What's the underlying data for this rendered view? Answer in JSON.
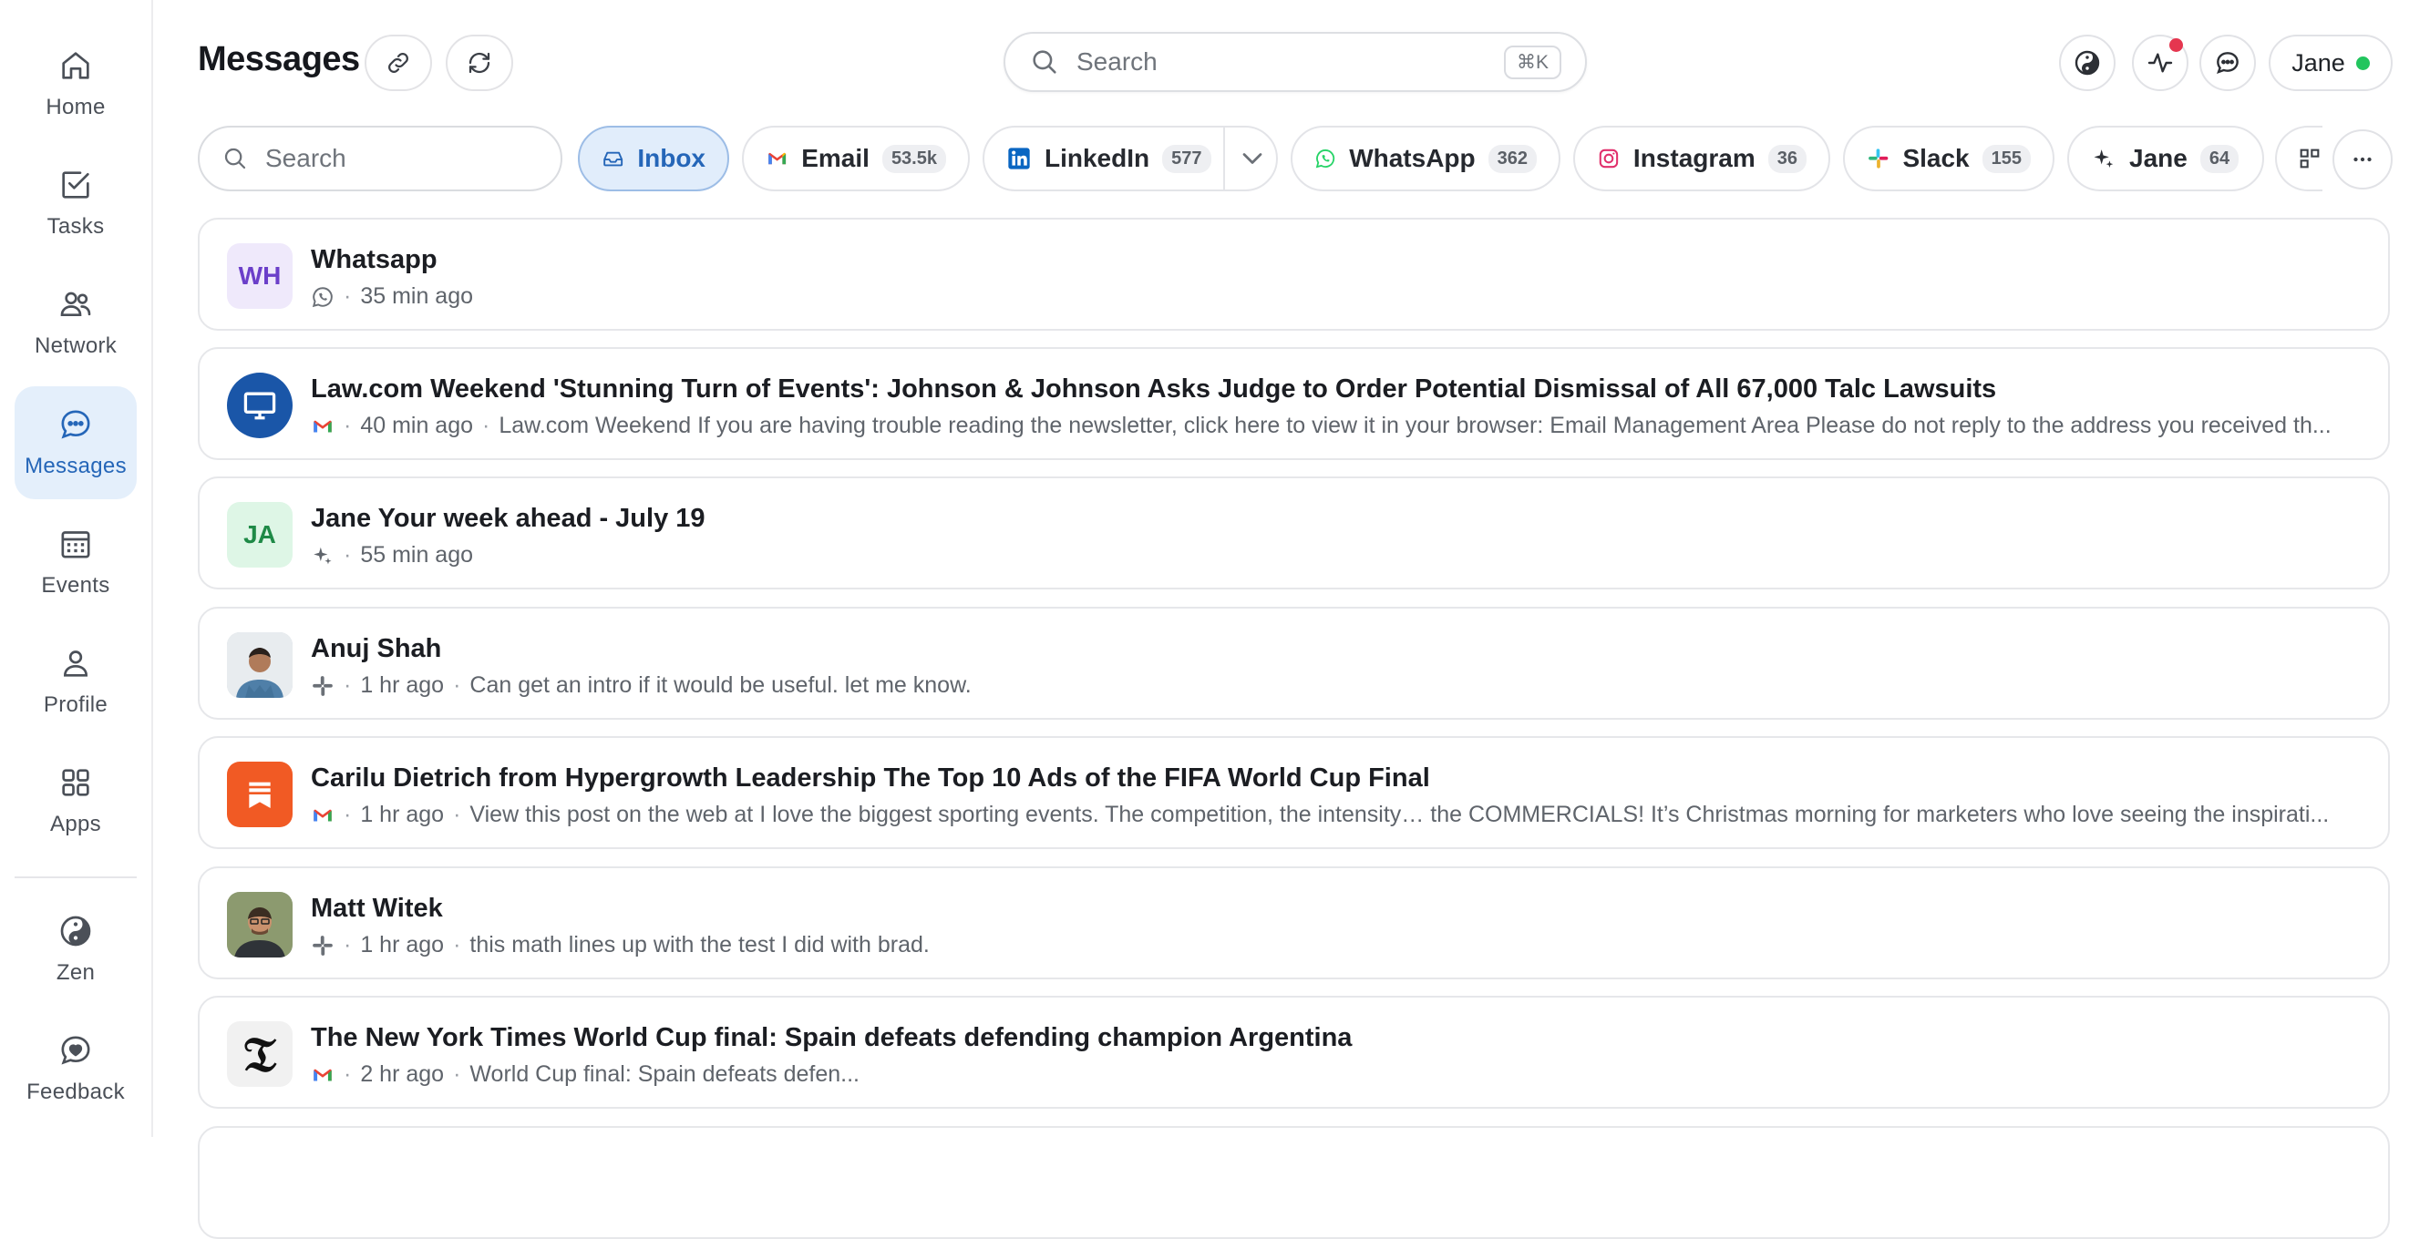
{
  "sidebar": {
    "items": [
      {
        "label": "Home",
        "icon": "home-icon"
      },
      {
        "label": "Tasks",
        "icon": "checkbox-icon"
      },
      {
        "label": "Network",
        "icon": "people-icon"
      },
      {
        "label": "Messages",
        "icon": "chat-icon",
        "active": true
      },
      {
        "label": "Events",
        "icon": "calendar-icon"
      },
      {
        "label": "Profile",
        "icon": "person-icon"
      },
      {
        "label": "Apps",
        "icon": "grid-icon"
      },
      {
        "label": "Zen",
        "icon": "yin-yang-icon"
      },
      {
        "label": "Feedback",
        "icon": "heart-chat-icon"
      }
    ]
  },
  "header": {
    "title": "Messages",
    "search_placeholder": "Search",
    "search_shortcut": "⌘K",
    "user_name": "Jane",
    "user_status_color": "#22c55e"
  },
  "filters": {
    "search_placeholder": "Search",
    "chips": [
      {
        "label": "Inbox",
        "count": null,
        "active": true
      },
      {
        "label": "Email",
        "count": "53.5k"
      },
      {
        "label": "LinkedIn",
        "count": "577"
      },
      {
        "label": "WhatsApp",
        "count": "362"
      },
      {
        "label": "Instagram",
        "count": "36"
      },
      {
        "label": "Slack",
        "count": "155"
      },
      {
        "label": "Jane",
        "count": "64"
      }
    ]
  },
  "messages": [
    {
      "title": "Whatsapp",
      "avatar_text": "WH",
      "source": "whatsapp",
      "time": "35 min ago",
      "snippet": ""
    },
    {
      "title": "Law.com Weekend 'Stunning Turn of Events': Johnson & Johnson Asks Judge to Order Potential Dismissal of All 67,000 Talc Lawsuits",
      "avatar_text": "",
      "source": "email",
      "time": "40 min ago",
      "snippet": "Law.com Weekend If you are having trouble reading the newsletter, click here to view it in your browser: Email Management Area Please do not reply to the address you received th..."
    },
    {
      "title": "Jane Your week ahead - July 19",
      "avatar_text": "JA",
      "source": "jane",
      "time": "55 min ago",
      "snippet": ""
    },
    {
      "title": "Anuj Shah",
      "avatar_text": "",
      "source": "slack",
      "time": "1 hr ago",
      "snippet": "Can get an intro if it would be useful. let me know."
    },
    {
      "title": "Carilu Dietrich from Hypergrowth Leadership The Top 10 Ads of the FIFA World Cup Final",
      "avatar_text": "",
      "source": "email",
      "time": "1 hr ago",
      "snippet": "View this post on the web at I love the biggest sporting events. The competition, the intensity… the COMMERCIALS! It’s Christmas morning for marketers who love seeing the inspirati..."
    },
    {
      "title": "Matt Witek",
      "avatar_text": "",
      "source": "slack",
      "time": "1 hr ago",
      "snippet": "this math lines up with the test I did with brad."
    },
    {
      "title": "The New York Times World Cup final: Spain defeats defending champion Argentina",
      "avatar_text": "",
      "source": "email",
      "time": "2 hr ago",
      "snippet": "World Cup final: Spain defeats defen..."
    }
  ],
  "colors": {
    "accent": "#2566b8",
    "active_bg": "#e4effb",
    "notification": "#e5364f"
  }
}
